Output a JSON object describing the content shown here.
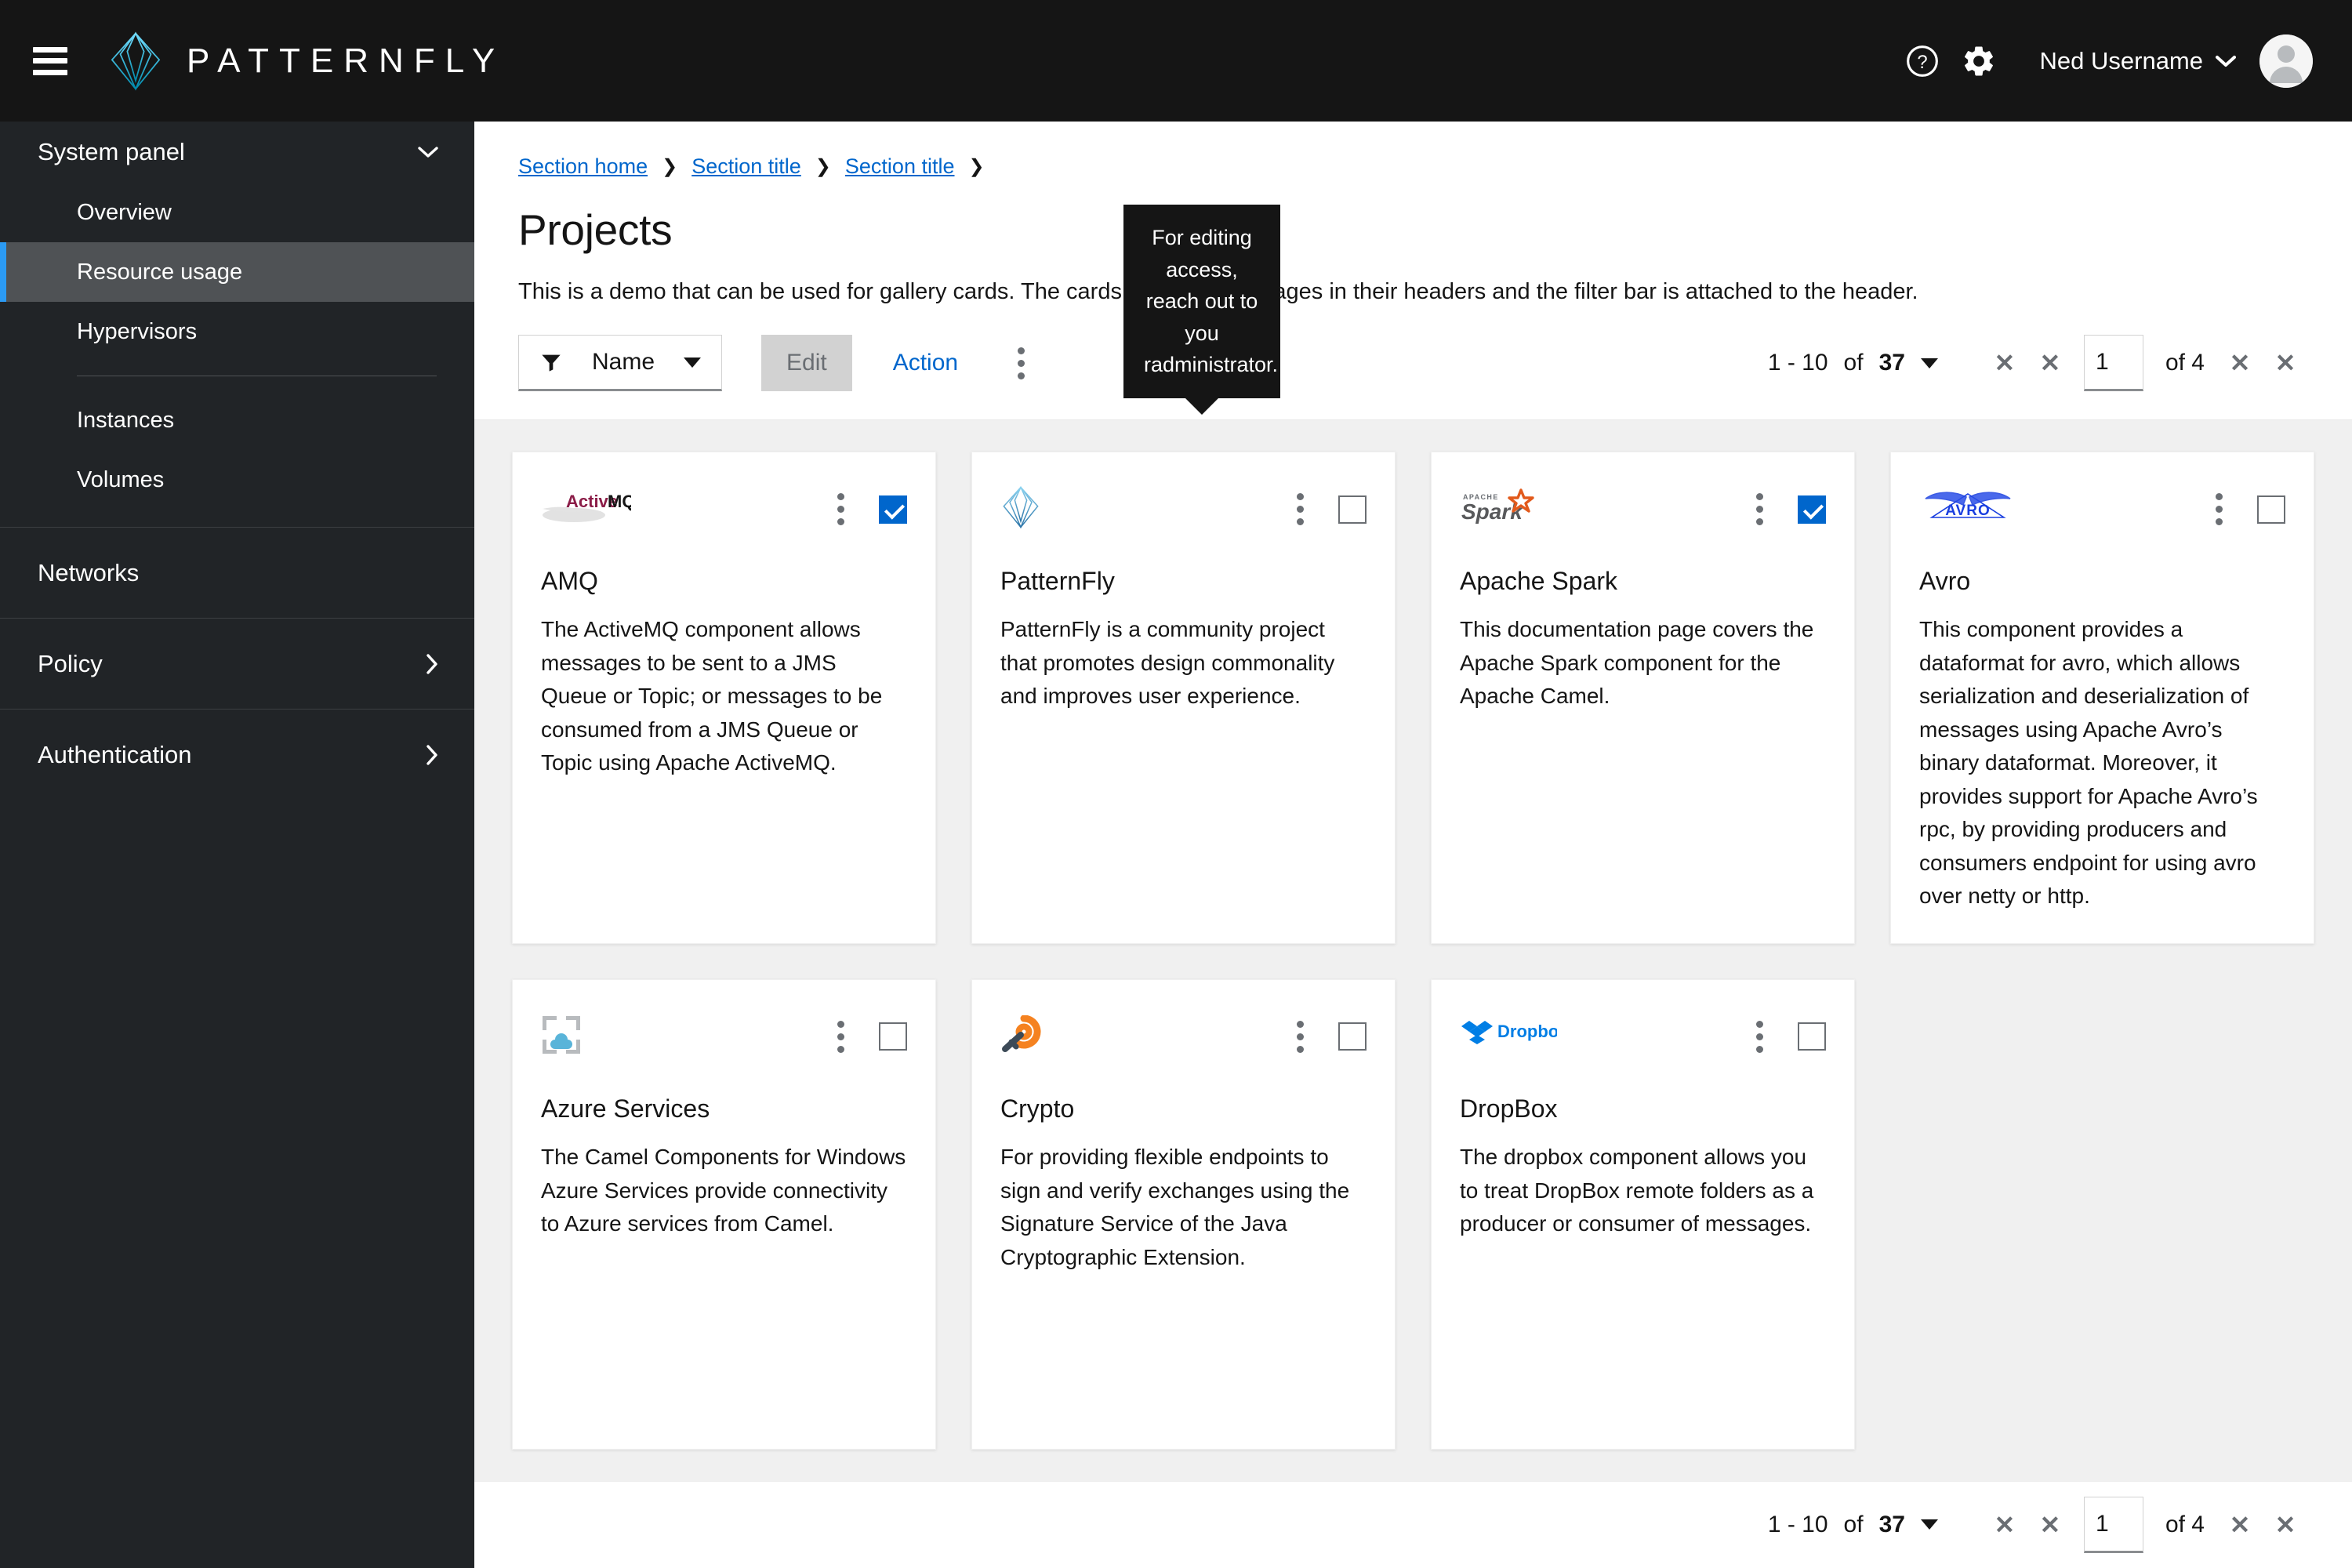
{
  "masthead": {
    "hamburger_label": "global-navigation-toggle",
    "brand_name": "PATTERNFLY",
    "help_label": "Help",
    "settings_label": "Settings",
    "username": "Ned Username"
  },
  "sidebar": {
    "group": {
      "label": "System panel",
      "items": [
        {
          "label": "Overview",
          "active": false
        },
        {
          "label": "Resource usage",
          "active": true
        },
        {
          "label": "Hypervisors",
          "active": false
        }
      ],
      "items2": [
        {
          "label": "Instances"
        },
        {
          "label": "Volumes"
        }
      ]
    },
    "sections": [
      {
        "label": "Networks",
        "expandable": false
      },
      {
        "label": "Policy",
        "expandable": true
      },
      {
        "label": "Authentication",
        "expandable": true
      }
    ]
  },
  "page": {
    "breadcrumb": [
      {
        "label": "Section home"
      },
      {
        "label": "Section title"
      },
      {
        "label": "Section title"
      }
    ],
    "title": "Projects",
    "description": "This is a demo that can be used for gallery cards. The cards below have images in their headers and the filter bar is attached to the header."
  },
  "toolbar": {
    "filter_label": "Name",
    "filter_icon": "filter-icon",
    "edit_label": "Edit",
    "action_label": "Action",
    "kebab_label": "more-actions",
    "tooltip_text": "For editing access, reach out to you radministrator."
  },
  "pagination": {
    "summary_range": "1 - 10",
    "summary_of": "of",
    "summary_total": "37",
    "first_label": "✕",
    "prev_label": "✕",
    "page_value": "1",
    "of_pages": "of 4",
    "next_label": "✕",
    "last_label": "✕"
  },
  "colors": {
    "accent_blue": "#06c",
    "link_blue": "#06c",
    "nav_active_bar": "#2b9af3",
    "masthead_bg": "#151515",
    "sidebar_bg": "#212427",
    "gallery_bg": "#f0f0f0"
  },
  "cards": [
    {
      "logo": "activemq-logo",
      "title": "AMQ",
      "body": "The ActiveMQ component allows messages to be sent to a JMS Queue or Topic; or messages to be consumed from a JMS Queue or Topic using Apache ActiveMQ.",
      "selected": true
    },
    {
      "logo": "patternfly-logo",
      "title": "PatternFly",
      "body": "PatternFly is a community project that promotes design commonality and improves user experience.",
      "selected": false
    },
    {
      "logo": "apache-spark-logo",
      "title": "Apache Spark",
      "body": "This documentation page covers the Apache Spark component for the Apache Camel.",
      "selected": true
    },
    {
      "logo": "avro-logo",
      "title": "Avro",
      "body": "This component provides a dataformat for avro, which allows serialization and deserialization of messages using Apache Avro’s binary dataformat. Moreover, it provides support for Apache Avro’s rpc, by providing producers and consumers endpoint for using avro over netty or http.",
      "selected": false
    },
    {
      "logo": "azure-logo",
      "title": "Azure Services",
      "body": "The Camel Components for Windows Azure Services provide connectivity to Azure services from Camel.",
      "selected": false
    },
    {
      "logo": "crypto-logo",
      "title": "Crypto",
      "body": "For providing flexible endpoints to sign and verify exchanges using the Signature Service of the Java Cryptographic Extension.",
      "selected": false
    },
    {
      "logo": "dropbox-logo",
      "title": "DropBox",
      "body": "The dropbox component allows you to treat DropBox remote folders as a producer or consumer of messages.",
      "selected": false
    }
  ]
}
